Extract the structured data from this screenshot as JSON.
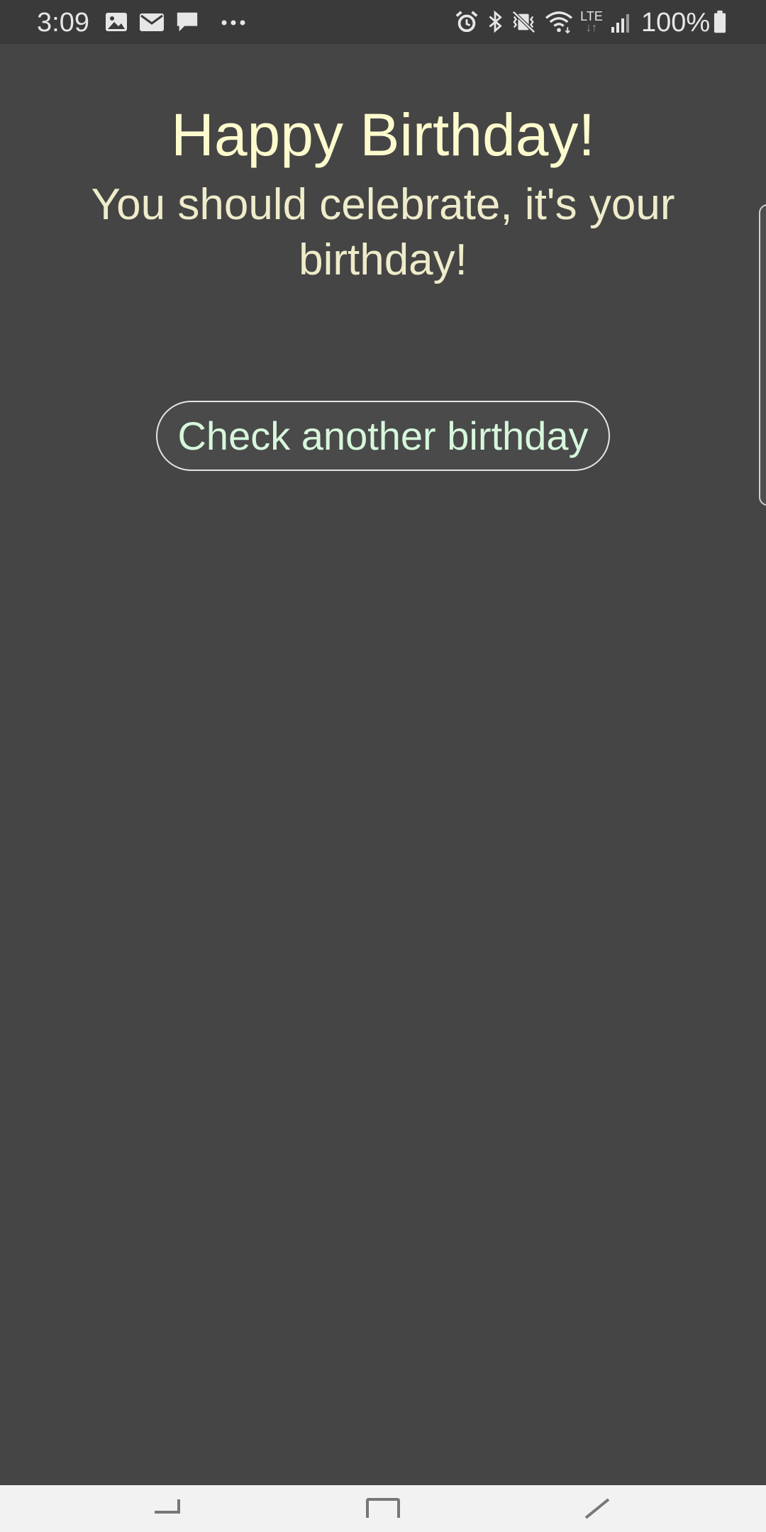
{
  "status_bar": {
    "time": "3:09",
    "battery_text": "100%",
    "notification_icons": [
      "image-icon",
      "email-icon",
      "chat-icon",
      "more-icon"
    ],
    "system_icons": [
      "alarm-icon",
      "bluetooth-icon",
      "vibrate-mute-icon",
      "wifi-icon",
      "lte-icon",
      "signal-icon",
      "battery-icon"
    ],
    "lte_label": "LTE",
    "battery_level": 1.0
  },
  "content": {
    "title": "Happy Birthday!",
    "subtitle": "You should celebrate, it's your birthday!",
    "check_button_label": "Check another birthday"
  },
  "nav_bar": {
    "buttons": [
      "recent-apps-icon",
      "home-icon",
      "back-icon"
    ]
  },
  "colors": {
    "background": "#454545",
    "title_text": "#fdfbcd",
    "subtitle_text": "#efeccb",
    "button_text": "#d6f7dc",
    "button_border": "#e4e4e4",
    "nav_bar": "#f2f2f2"
  }
}
